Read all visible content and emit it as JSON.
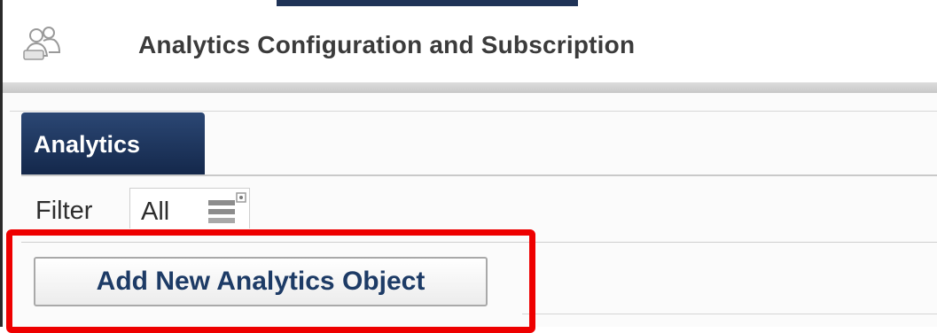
{
  "header": {
    "title": "Analytics Configuration and Subscription",
    "icon": "users-icon"
  },
  "tabs": [
    {
      "label": "Analytics",
      "active": true
    }
  ],
  "filter": {
    "label": "Filter",
    "selected_value": "All",
    "icon": "list-dropdown-icon"
  },
  "actions": {
    "add_button_label": "Add New Analytics Object"
  },
  "annotation": {
    "highlight_color": "#ee0000"
  },
  "colors": {
    "tab_background": "#1e3660",
    "button_text": "#1d3b66"
  }
}
